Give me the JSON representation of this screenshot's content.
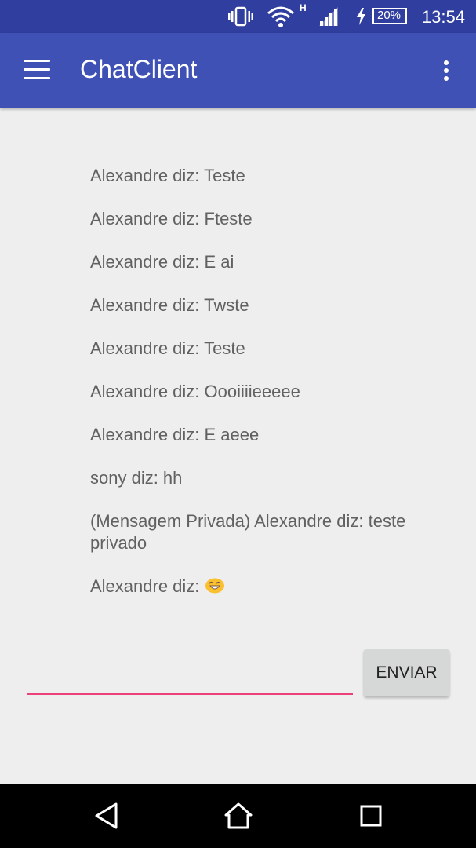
{
  "status_bar": {
    "time": "13:54",
    "battery": "20%",
    "network": "H",
    "icons": [
      "vibrate-icon",
      "wifi-icon",
      "signal-icon",
      "battery-charging-icon"
    ]
  },
  "app_bar": {
    "title": "ChatClient",
    "icons": [
      "hamburger-menu-icon",
      "overflow-menu-icon"
    ]
  },
  "messages": [
    "Alexandre diz: Teste",
    "Alexandre diz: Fteste",
    "Alexandre diz: E ai",
    "Alexandre diz: Twste",
    "Alexandre diz: Teste",
    "Alexandre diz: Oooiiiieeeee",
    "Alexandre diz: E aeee",
    "sony diz: hh",
    "(Mensagem Privada) Alexandre diz: teste privado",
    "Alexandre diz: "
  ],
  "composer": {
    "value": "",
    "send_label": "ENVIAR"
  },
  "nav_bar": {
    "icons": [
      "back-icon",
      "home-icon",
      "recents-icon"
    ]
  },
  "colors": {
    "primary": "#3f51b5",
    "primary_dark": "#303f9f",
    "accent": "#ec407a",
    "background": "#eeeeee"
  }
}
